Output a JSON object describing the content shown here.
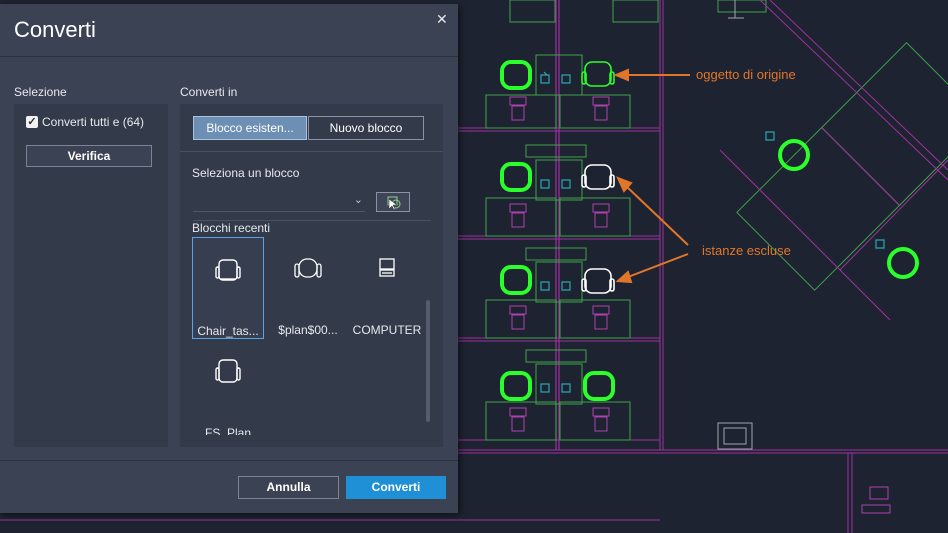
{
  "dialog": {
    "title": "Converti",
    "close_icon": "close-icon",
    "selection": {
      "label": "Selezione",
      "checkbox_label": "Converti tutti e (64)",
      "checked": true,
      "verify_label": "Verifica"
    },
    "convert_to": {
      "label": "Converti in",
      "tabs": [
        {
          "label": "Blocco esisten...",
          "selected": true
        },
        {
          "label": "Nuovo blocco",
          "selected": false
        }
      ],
      "select_block_label": "Seleziona un blocco",
      "dropdown_value": "",
      "recent_label": "Blocchi recenti",
      "recent_blocks": [
        {
          "name": "Chair_tas...",
          "icon": "chair-task-icon",
          "selected": true
        },
        {
          "name": "$plan$00...",
          "icon": "chair-plan-icon",
          "selected": false
        },
        {
          "name": "COMPUTER",
          "icon": "computer-icon",
          "selected": false
        },
        {
          "name": "FS_Plan",
          "icon": "chair-fs-icon",
          "selected": false
        }
      ]
    },
    "footer": {
      "cancel_label": "Annulla",
      "convert_label": "Converti"
    }
  },
  "annotations": {
    "source_object": "oggetto di origine",
    "excluded_instances": "istanze escluse"
  },
  "colors": {
    "dialog_bg": "#3b4253",
    "panel_bg": "#333a49",
    "primary_button": "#1f8fd6",
    "drawing_bg": "#1d2330",
    "chair_green": "#2bff2b",
    "wall_magenta": "#a030a0",
    "annotation_orange": "#e1762a"
  }
}
